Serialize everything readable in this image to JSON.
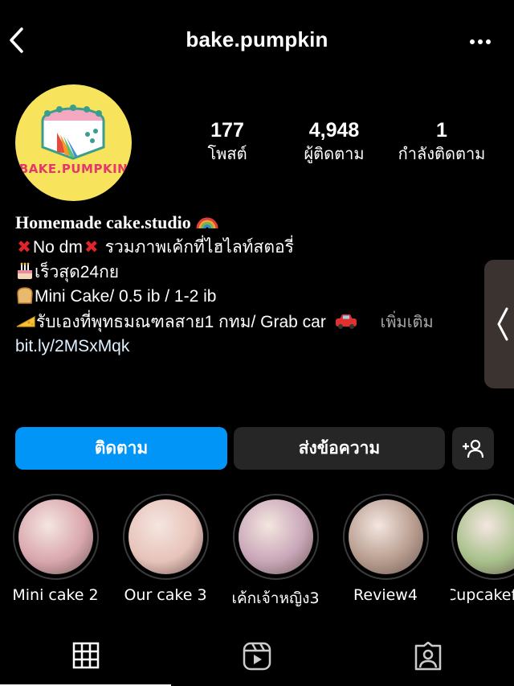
{
  "header": {
    "username": "bake.pumpkin"
  },
  "avatar": {
    "logo_text": "BAKE.PUMPKIN"
  },
  "stats": {
    "posts": {
      "value": "177",
      "label": "โพสต์"
    },
    "followers": {
      "value": "4,948",
      "label": "ผู้ติดตาม"
    },
    "following": {
      "value": "1",
      "label": "กำลังติดตาม"
    }
  },
  "bio": {
    "name": "Homemade cake.studio",
    "line1_a": "No dm",
    "line1_b": "รวมภาพเค้กที่ไฮไลท์สตอรี่",
    "line2": "เร็วสุด24กย",
    "line3": "Mini Cake/ 0.5 ib / 1-2 ib",
    "line4": "รับเองที่พุทธมณฑลสาย1 กทม/ Grab car",
    "more": "เพิ่มเติม",
    "link": "bit.ly/2MSxMqk"
  },
  "buttons": {
    "follow": "ติดตาม",
    "message": "ส่งข้อความ"
  },
  "highlights": [
    {
      "label": "Mini cake 2",
      "color": "#d9a6ad"
    },
    {
      "label": "Our cake 3",
      "color": "#e7c2b9"
    },
    {
      "label": "เค้กเจ้าหญิง3",
      "color": "#c8a6b8"
    },
    {
      "label": "Review4",
      "color": "#b79c8e"
    },
    {
      "label": "Cupcakef",
      "color": "#a7c08a"
    }
  ],
  "icons": {
    "back": "chevron-left-icon",
    "more": "more-horizontal-icon",
    "add_user": "add-user-icon",
    "grid": "grid-icon",
    "reels": "reels-icon",
    "tagged": "tagged-icon"
  },
  "colors": {
    "accent": "#0095f6",
    "background": "#000000",
    "button": "#262626"
  }
}
